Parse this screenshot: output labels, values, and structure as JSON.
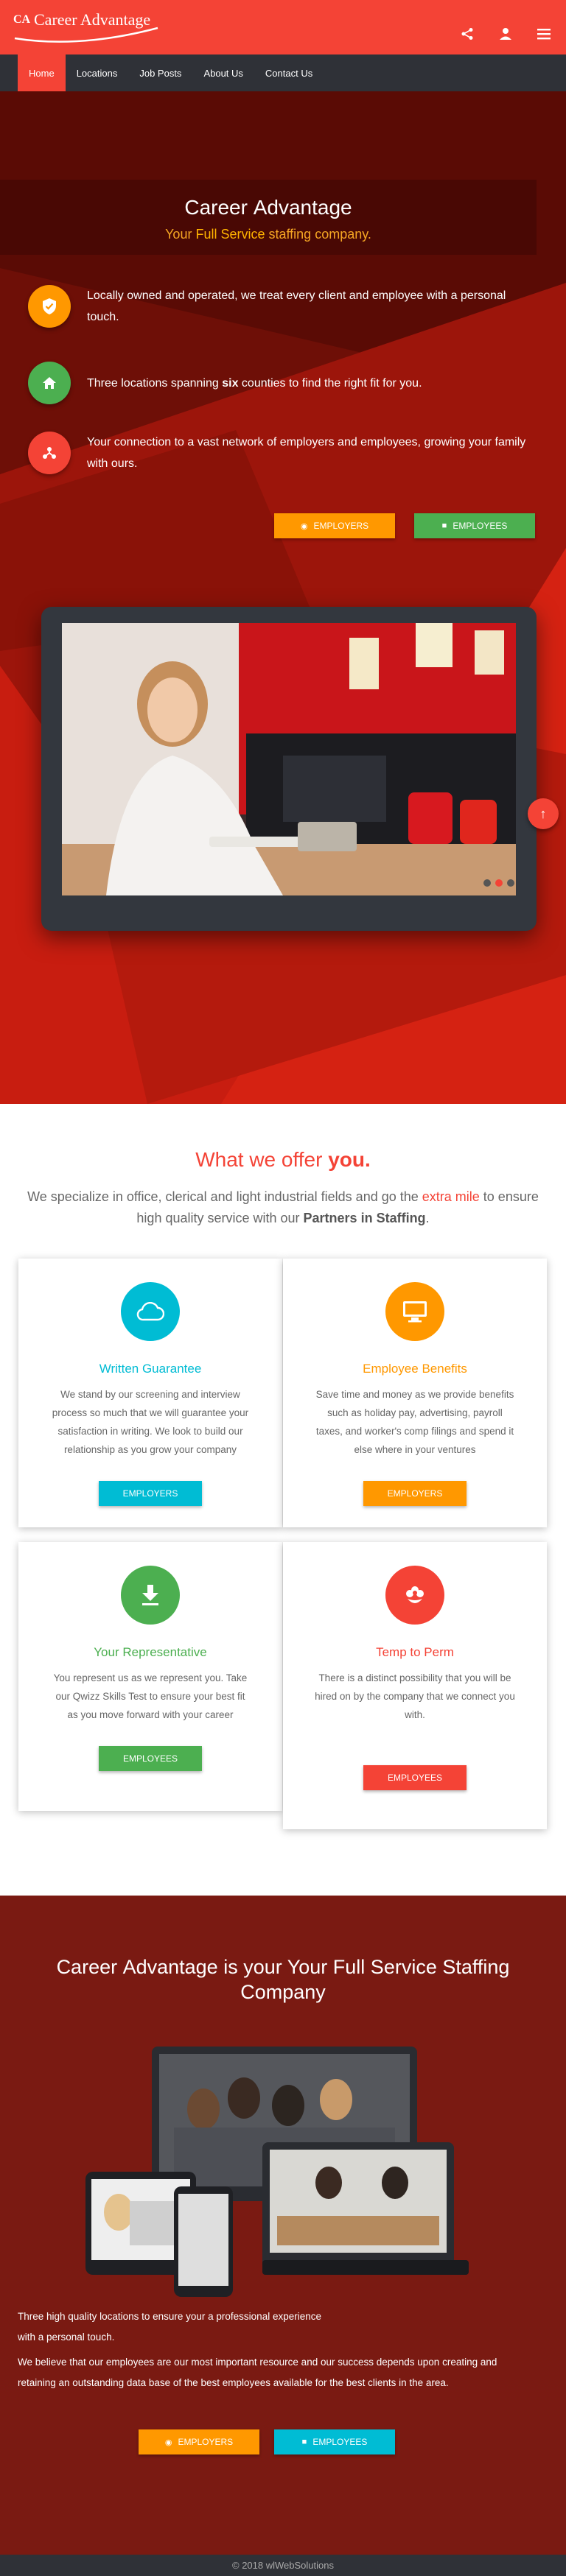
{
  "brand": {
    "name": "Career Advantage",
    "mark": "CA"
  },
  "header": {
    "icons": [
      "share-icon",
      "person-icon",
      "menu-icon"
    ]
  },
  "nav": {
    "items": [
      {
        "label": "Home",
        "active": true
      },
      {
        "label": "Locations",
        "active": false
      },
      {
        "label": "Job Posts",
        "active": false
      },
      {
        "label": "About Us",
        "active": false
      },
      {
        "label": "Contact Us",
        "active": false
      }
    ]
  },
  "hero": {
    "title_a": "Career ",
    "title_b": "Advantage",
    "sub_a": "Your ",
    "sub_hl": "Full Service",
    "sub_b": " staffing company.",
    "features": [
      {
        "text": "Locally owned and operated, we treat every client and employee with a personal touch.",
        "icon": "shield-check-icon",
        "color": "#ff9800"
      },
      {
        "text_a": "Three locations spanning ",
        "text_b": "six",
        "text_c": " counties to find the right fit for you.",
        "icon": "home-icon",
        "color": "#4caf50"
      },
      {
        "text": "Your connection to a vast network of employers and employees, growing your family with ours.",
        "icon": "network-icon",
        "color": "#f44336"
      }
    ],
    "btn_employers": "Employers",
    "btn_employees": "Employees"
  },
  "offer": {
    "title_a": "What we offer ",
    "title_b": "you.",
    "intro_a": "We specialize in office, clerical and light industrial fields and go the ",
    "intro_hl": "extra mile",
    "intro_b": " to ensure high quality service with our ",
    "intro_bold": "Partners in Staffing",
    "intro_c": ".",
    "cards": [
      {
        "title": "Written Guarantee",
        "text": "We stand by our screening and interview process so much that we will guarantee your satisfaction in writing. We look to build our relationship as you grow your company",
        "button": "Employers",
        "color": "#00bcd4",
        "icon": "cloud-icon"
      },
      {
        "title": "Employee Benefits",
        "text": "Save time and money as we provide benefits such as holiday pay, advertising, payroll taxes, and worker's comp filings and spend it else where in your ventures",
        "button": "Employers",
        "color": "#ff9800",
        "icon": "monitor-icon"
      },
      {
        "title": "Your Representative",
        "text": "You represent us as we represent you. Take our Qwizz Skills Test to ensure your best fit as you move forward with your career",
        "button": "Employees",
        "color": "#4caf50",
        "icon": "download-icon"
      },
      {
        "title": "Temp to Perm",
        "text": "There is a distinct possibility that you will be hired on by the company that we connect you with.",
        "button": "Employees",
        "color": "#f44336",
        "icon": "flower-icon"
      }
    ]
  },
  "bottom": {
    "title_a": "Career ",
    "title_b": "Advantage",
    "title_c": " is your Your Full Service Staffing Company",
    "p1": "Three high quality locations to ensure your a professional experience",
    "p2": "with a personal touch.",
    "p3": "We believe that our employees are our most important resource and our success depends upon creating and retaining an outstanding data base of the best employees available for the best clients in the area.",
    "btn_employers": "Employers",
    "btn_employees": "Employees"
  },
  "footer": {
    "text": "© 2018 wlWebSolutions"
  }
}
